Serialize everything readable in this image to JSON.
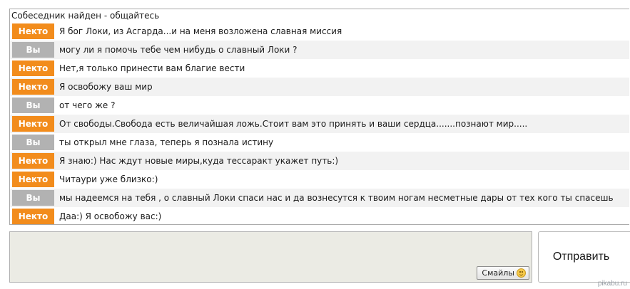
{
  "chat": {
    "status": "Собеседник найден - общайтесь",
    "messages": [
      {
        "sender": "Некто",
        "role": "stranger",
        "text": "Я бог Локи, из Асгарда...и на меня возложена славная миссия"
      },
      {
        "sender": "Вы",
        "role": "you",
        "text": "могу ли я помочь тебе чем нибудь о славный Локи ?"
      },
      {
        "sender": "Некто",
        "role": "stranger",
        "text": "Нет,я только принести вам благие вести"
      },
      {
        "sender": "Некто",
        "role": "stranger",
        "text": "Я освобожу ваш мир"
      },
      {
        "sender": "Вы",
        "role": "you",
        "text": "от чего же ?"
      },
      {
        "sender": "Некто",
        "role": "stranger",
        "text": "От свободы.Свобода есть величайшая ложь.Стоит вам это принять и ваши сердца.......познают мир....."
      },
      {
        "sender": "Вы",
        "role": "you",
        "text": "ты открыл мне глаза, теперь я познала истину"
      },
      {
        "sender": "Некто",
        "role": "stranger",
        "text": "Я знаю:) Нас ждут новые миры,куда тессаракт укажет путь:)"
      },
      {
        "sender": "Некто",
        "role": "stranger",
        "text": "Читаури уже близко:)"
      },
      {
        "sender": "Вы",
        "role": "you",
        "text": "мы надеемся на тебя , о славный Локи спаси нас и да вознесутся к твоим ногам несметные дары от тех кого ты спасешь"
      },
      {
        "sender": "Некто",
        "role": "stranger",
        "text": "Даа:) Я освобожу вас:)"
      }
    ]
  },
  "composer": {
    "smiles_label": "Смайлы",
    "send_label": "Отправить"
  },
  "watermark": "pikabu.ru",
  "colors": {
    "stranger_badge": "#f28c1c",
    "you_badge": "#b2b2b2",
    "input_bg": "#ebebe4"
  }
}
